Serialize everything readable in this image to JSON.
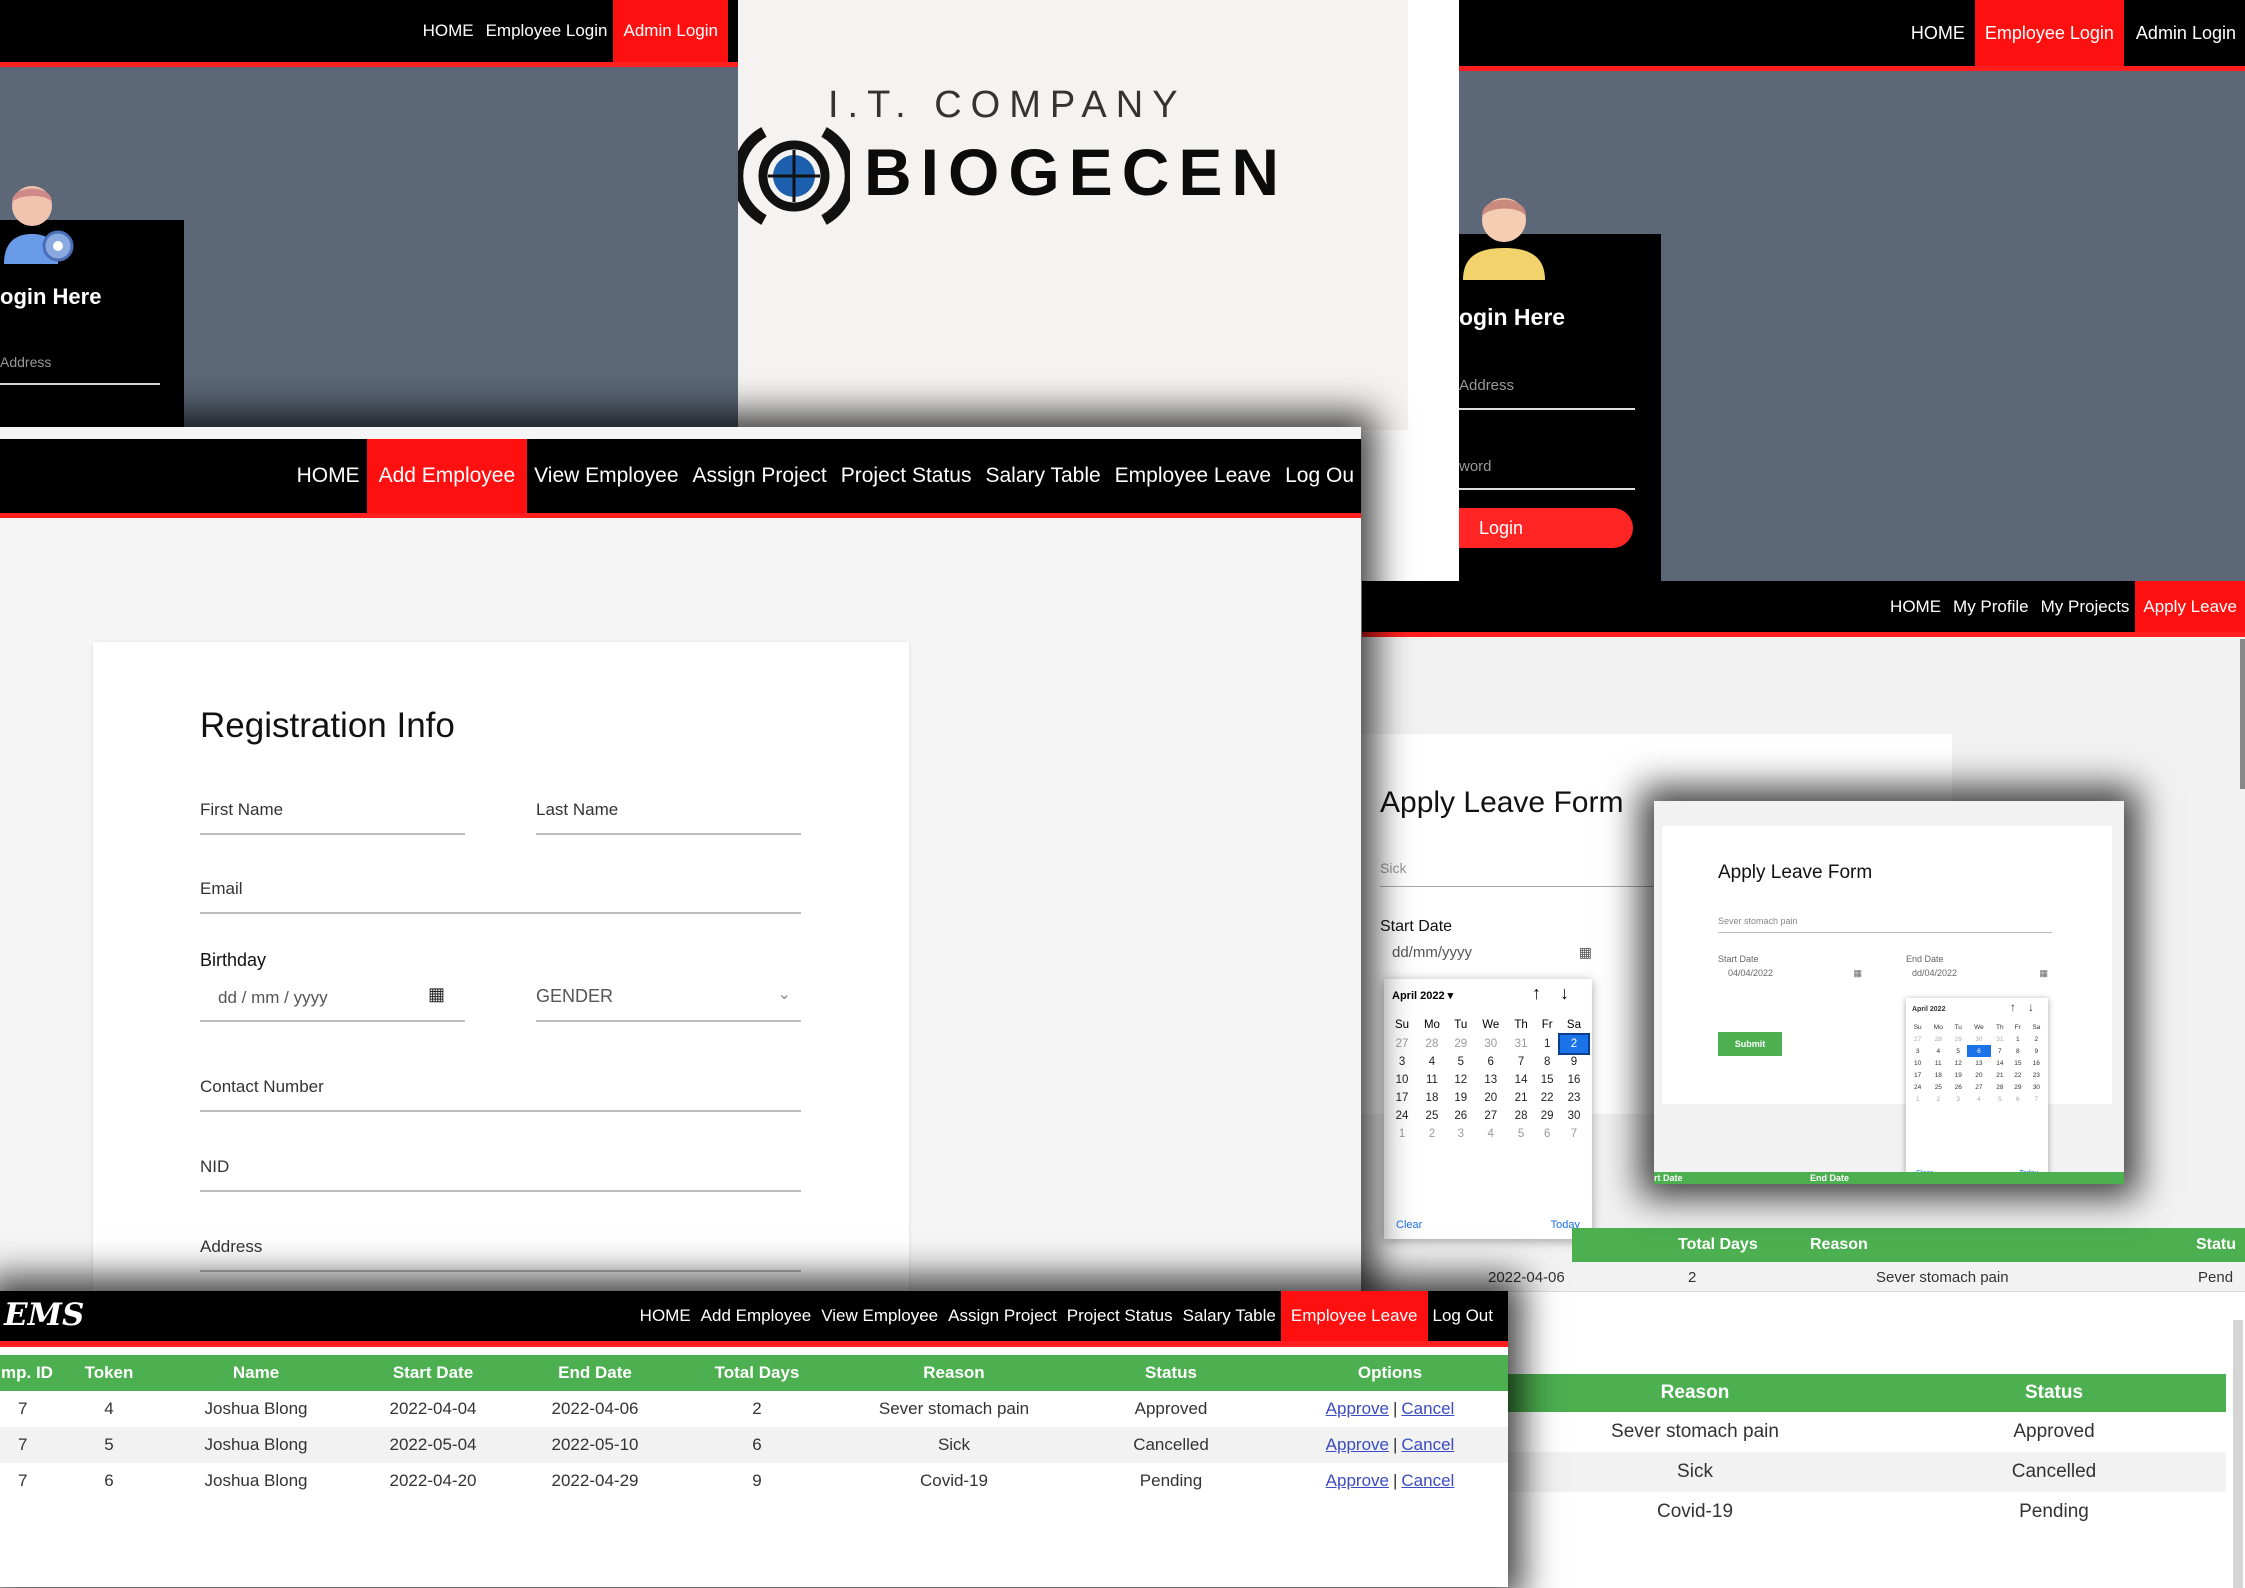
{
  "admin_login_page": {
    "nav": [
      "HOME",
      "Employee Login",
      "Admin Login"
    ],
    "active_index": 2,
    "login_heading": "ogin Here",
    "email_placeholder": "Address"
  },
  "company_logo": {
    "tagline": "I.T. COMPANY",
    "name": "BIOGECEN"
  },
  "employee_login_page": {
    "nav": [
      "HOME",
      "Employee Login",
      "Admin Login"
    ],
    "active_index": 1,
    "login_heading": "ogin Here",
    "email_placeholder": "Address",
    "password_placeholder": "word",
    "login_button": "Login"
  },
  "add_employee_page": {
    "nav": [
      "HOME",
      "Add Employee",
      "View Employee",
      "Assign Project",
      "Project Status",
      "Salary Table",
      "Employee Leave",
      "Log Ou"
    ],
    "active_index": 1,
    "form": {
      "title": "Registration Info",
      "first_name": "First Name",
      "last_name": "Last Name",
      "email": "Email",
      "birthday_label": "Birthday",
      "birthday_placeholder": "dd / mm / yyyy",
      "gender": "GENDER",
      "contact": "Contact Number",
      "nid": "NID",
      "address": "Address"
    }
  },
  "apply_leave_page": {
    "nav": [
      "HOME",
      "My Profile",
      "My Projects",
      "Apply Leave"
    ],
    "active_index": 3,
    "title": "Apply Leave Form",
    "reason_value": "Sick",
    "start_date_label": "Start Date",
    "start_date_value": "dd/mm/yyyy",
    "calendar": {
      "month": "April 2022",
      "weekdays": [
        "Su",
        "Mo",
        "Tu",
        "We",
        "Th",
        "Fr",
        "Sa"
      ],
      "weeks": [
        [
          "27",
          "28",
          "29",
          "30",
          "31",
          "1",
          "2"
        ],
        [
          "3",
          "4",
          "5",
          "6",
          "7",
          "8",
          "9"
        ],
        [
          "10",
          "11",
          "12",
          "13",
          "14",
          "15",
          "16"
        ],
        [
          "17",
          "18",
          "19",
          "20",
          "21",
          "22",
          "23"
        ],
        [
          "24",
          "25",
          "26",
          "27",
          "28",
          "29",
          "30"
        ],
        [
          "1",
          "2",
          "3",
          "4",
          "5",
          "6",
          "7"
        ]
      ],
      "selected": "2",
      "clear": "Clear",
      "today": "Today"
    },
    "table_headers": [
      "Total Days",
      "Reason",
      "Statu"
    ],
    "table_row": [
      "2022-04-06",
      "2",
      "Sever stomach pain",
      "Pend"
    ],
    "inset": {
      "title": "Apply Leave Form",
      "reason_value": "Sever stomach pain",
      "start_date_label": "Start Date",
      "start_date_value": "04/04/2022",
      "end_date_label": "End Date",
      "end_date_value": "dd/04/2022",
      "submit": "Submit",
      "calendar_month": "April 2022",
      "table_headers": [
        "rt Date",
        "End Date"
      ]
    }
  },
  "employee_leave_page": {
    "logo": "EMS",
    "nav": [
      "HOME",
      "Add Employee",
      "View Employee",
      "Assign Project",
      "Project Status",
      "Salary Table",
      "Employee Leave",
      "Log Out"
    ],
    "active_index": 6,
    "table": {
      "headers": [
        "mp. ID",
        "Token",
        "Name",
        "Start Date",
        "End Date",
        "Total Days",
        "Reason",
        "Status",
        "Options"
      ],
      "rows": [
        [
          "7",
          "4",
          "Joshua Blong",
          "2022-04-04",
          "2022-04-06",
          "2",
          "Sever stomach pain",
          "Approved"
        ],
        [
          "7",
          "5",
          "Joshua Blong",
          "2022-05-04",
          "2022-05-10",
          "6",
          "Sick",
          "Cancelled"
        ],
        [
          "7",
          "6",
          "Joshua Blong",
          "2022-04-20",
          "2022-04-29",
          "9",
          "Covid-19",
          "Pending"
        ]
      ],
      "approve": "Approve",
      "separator": "|",
      "cancel": "Cancel"
    }
  },
  "leave_status_page": {
    "headers": [
      "Reason",
      "Status"
    ],
    "rows": [
      [
        "Sever stomach pain",
        "Approved"
      ],
      [
        "Sick",
        "Cancelled"
      ],
      [
        "Covid-19",
        "Pending"
      ]
    ]
  },
  "colors": {
    "nav_bg": "#000000",
    "nav_active": "#ff1010",
    "accent_red": "#ff1f1f",
    "table_header_green": "#4caf50",
    "slate_bg": "#5c6777"
  }
}
